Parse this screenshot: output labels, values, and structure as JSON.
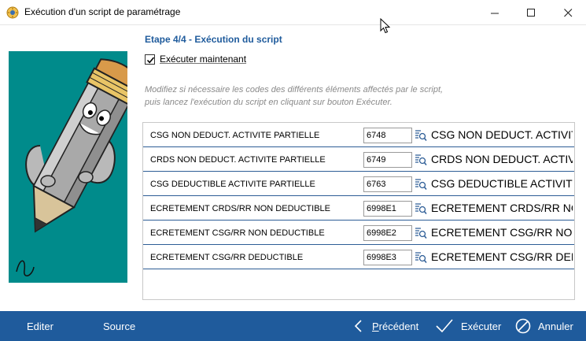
{
  "window": {
    "title": "Exécution d'un script de paramétrage",
    "controls": {
      "minimize_icon": "minimize-icon",
      "maximize_icon": "maximize-icon",
      "close_icon": "close-icon"
    }
  },
  "step": {
    "title": "Etape 4/4 - Exécution du script",
    "execute_now_label": "Exécuter maintenant",
    "execute_now_checked": true,
    "help_line1": "Modifiez si nécessaire les codes des différents éléments affectés par le script,",
    "help_line2": "puis lancez l'exécution du script en cliquant sur bouton Exécuter."
  },
  "rows": [
    {
      "label": "CSG NON DEDUCT. ACTIVITE PARTIELLE",
      "code": "6748",
      "description": "CSG NON DEDUCT. ACTIVITE PARTIELLE"
    },
    {
      "label": "CRDS NON DEDUCT. ACTIVITE PARTIELLE",
      "code": "6749",
      "description": "CRDS NON DEDUCT. ACTIVITE PARTIELLE"
    },
    {
      "label": "CSG DEDUCTIBLE ACTIVITE PARTIELLE",
      "code": "6763",
      "description": "CSG DEDUCTIBLE ACTIVITE PARTIELLE"
    },
    {
      "label": "ECRETEMENT CRDS/RR NON DEDUCTIBLE",
      "code": "6998E1",
      "description": "ECRETEMENT CRDS/RR NON DEDUCTIBLE"
    },
    {
      "label": "ECRETEMENT CSG/RR NON DEDUCTIBLE",
      "code": "6998E2",
      "description": "ECRETEMENT CSG/RR NON DEDUCTIBLE"
    },
    {
      "label": "ECRETEMENT CSG/RR DEDUCTIBLE",
      "code": "6998E3",
      "description": "ECRETEMENT CSG/RR DEDUCTIBLE"
    }
  ],
  "footer": {
    "editer": "Editer",
    "source": "Source",
    "precedent_first": "P",
    "precedent_rest": "récédent",
    "executer": "Exécuter",
    "annuler": "Annuler"
  },
  "colors": {
    "accent": "#1f5b9c",
    "illustration_bg": "#008b8b",
    "row_separator": "#2d5d96",
    "help_text": "#8a8a8a"
  },
  "icons": {
    "app": "script-app-icon",
    "lookup": "lookup-icon",
    "previous": "chevron-left-icon",
    "execute": "checkmark-icon",
    "cancel": "cancel-circle-icon"
  }
}
